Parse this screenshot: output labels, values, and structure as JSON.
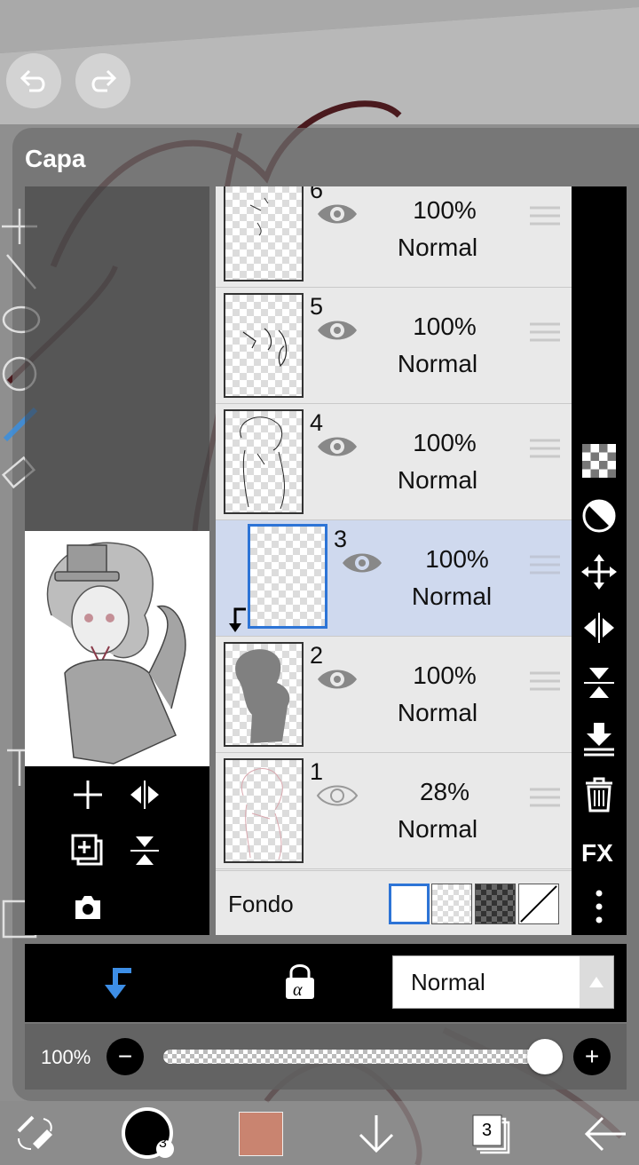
{
  "panel": {
    "title": "Capa"
  },
  "layers": [
    {
      "number": "6",
      "opacity": "100%",
      "mode": "Normal",
      "visible": true,
      "selected": false
    },
    {
      "number": "5",
      "opacity": "100%",
      "mode": "Normal",
      "visible": true,
      "selected": false
    },
    {
      "number": "4",
      "opacity": "100%",
      "mode": "Normal",
      "visible": true,
      "selected": false
    },
    {
      "number": "3",
      "opacity": "100%",
      "mode": "Normal",
      "visible": true,
      "selected": true,
      "clipping": true
    },
    {
      "number": "2",
      "opacity": "100%",
      "mode": "Normal",
      "visible": true,
      "selected": false
    },
    {
      "number": "1",
      "opacity": "28%",
      "mode": "Normal",
      "visible": true,
      "selected": false
    }
  ],
  "background": {
    "label": "Fondo",
    "options": [
      "white",
      "transparent",
      "dark-checker",
      "none"
    ],
    "selected": "white"
  },
  "blend": {
    "value": "Normal"
  },
  "opacity": {
    "label": "100%",
    "level_percent": 100
  },
  "toolbar": {
    "layer_count": "3",
    "brush_size": "3",
    "color": "#c98470"
  },
  "colors": {
    "accent": "#2d74d6",
    "selected_layer": "#cfd9ee"
  }
}
